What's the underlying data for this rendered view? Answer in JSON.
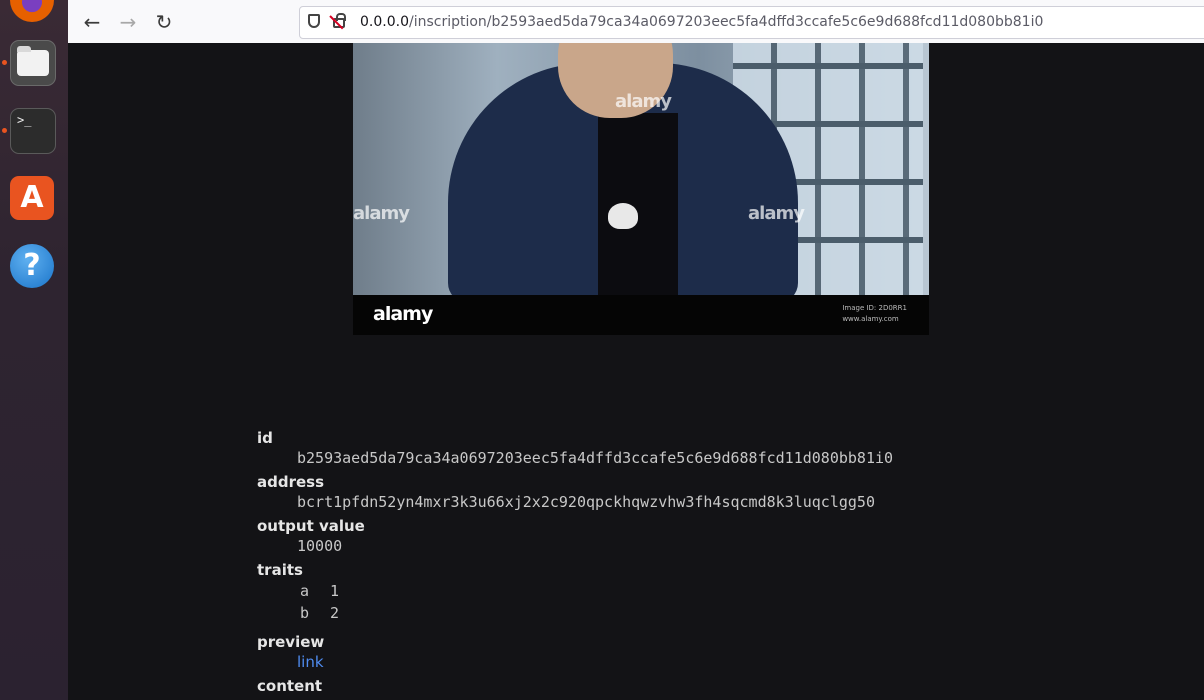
{
  "dock": {
    "apps": [
      {
        "name": "Firefox",
        "icon": "firefox-icon"
      },
      {
        "name": "Files",
        "icon": "folder-icon"
      },
      {
        "name": "Terminal",
        "icon": "terminal-icon",
        "glyph": ">_"
      },
      {
        "name": "Ubuntu Software",
        "icon": "app-store-icon",
        "glyph": "A"
      },
      {
        "name": "Help",
        "icon": "help-icon",
        "glyph": "?"
      }
    ]
  },
  "browser": {
    "url_host": "0.0.0.0",
    "url_path": "/inscription/b2593aed5da79ca34a0697203eec5fa4dffd3ccafe5c6e9d688fcd11d080bb81i0"
  },
  "image": {
    "watermark": "alamy",
    "band_logo": "alamy",
    "band_info": [
      "Image ID: 2D0RR1",
      "www.alamy.com"
    ]
  },
  "inscription": {
    "id_label": "id",
    "id": "b2593aed5da79ca34a0697203eec5fa4dffd3ccafe5c6e9d688fcd11d080bb81i0",
    "address_label": "address",
    "address": "bcrt1pfdn52yn4mxr3k3u66xj2x2c920qpckhqwzvhw3fh4sqcmd8k3luqclgg50",
    "output_value_label": "output value",
    "output_value": "10000",
    "traits_label": "traits",
    "traits": [
      {
        "key": "a",
        "value": "1"
      },
      {
        "key": "b",
        "value": "2"
      }
    ],
    "preview_label": "preview",
    "preview_link": "link",
    "content_label": "content"
  },
  "colors": {
    "page_bg": "#131316",
    "link": "#4f8cf0",
    "dock_accent": "#e95420"
  }
}
